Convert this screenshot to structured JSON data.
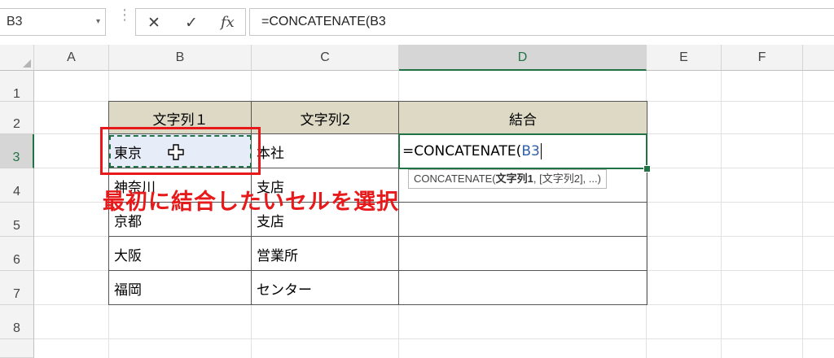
{
  "formula_bar": {
    "name_box": "B3",
    "name_box_dropdown": "▾",
    "dots": "⋮",
    "cancel_icon": "✕",
    "enter_icon": "✓",
    "fx_label": "fx",
    "formula": "=CONCATENATE(B3"
  },
  "columns": [
    "A",
    "B",
    "C",
    "D",
    "E",
    "F"
  ],
  "rows": [
    "1",
    "2",
    "3",
    "4",
    "5",
    "6",
    "7",
    "8"
  ],
  "selected_column": "D",
  "selected_row": "3",
  "table": {
    "headers": [
      "文字列１",
      "文字列2",
      "結合"
    ],
    "rows": [
      [
        "東京",
        "本社",
        ""
      ],
      [
        "神奈川",
        "支店",
        ""
      ],
      [
        "京都",
        "支店",
        ""
      ],
      [
        "大阪",
        "営業所",
        ""
      ],
      [
        "福岡",
        "センター",
        ""
      ]
    ],
    "header_fill": "#ddd9c4"
  },
  "editing_cell": {
    "prefix": "=CONCATENATE(",
    "ref": "B3"
  },
  "tooltip": {
    "func": "CONCATENATE(",
    "arg1": "文字列1",
    "rest": ", [文字列2], ...)"
  },
  "annotation": "最初に結合したいセルを選択",
  "colors": {
    "accent": "#217346",
    "annotation_red": "#e8191a",
    "reference_blue": "#2f5fa8"
  }
}
